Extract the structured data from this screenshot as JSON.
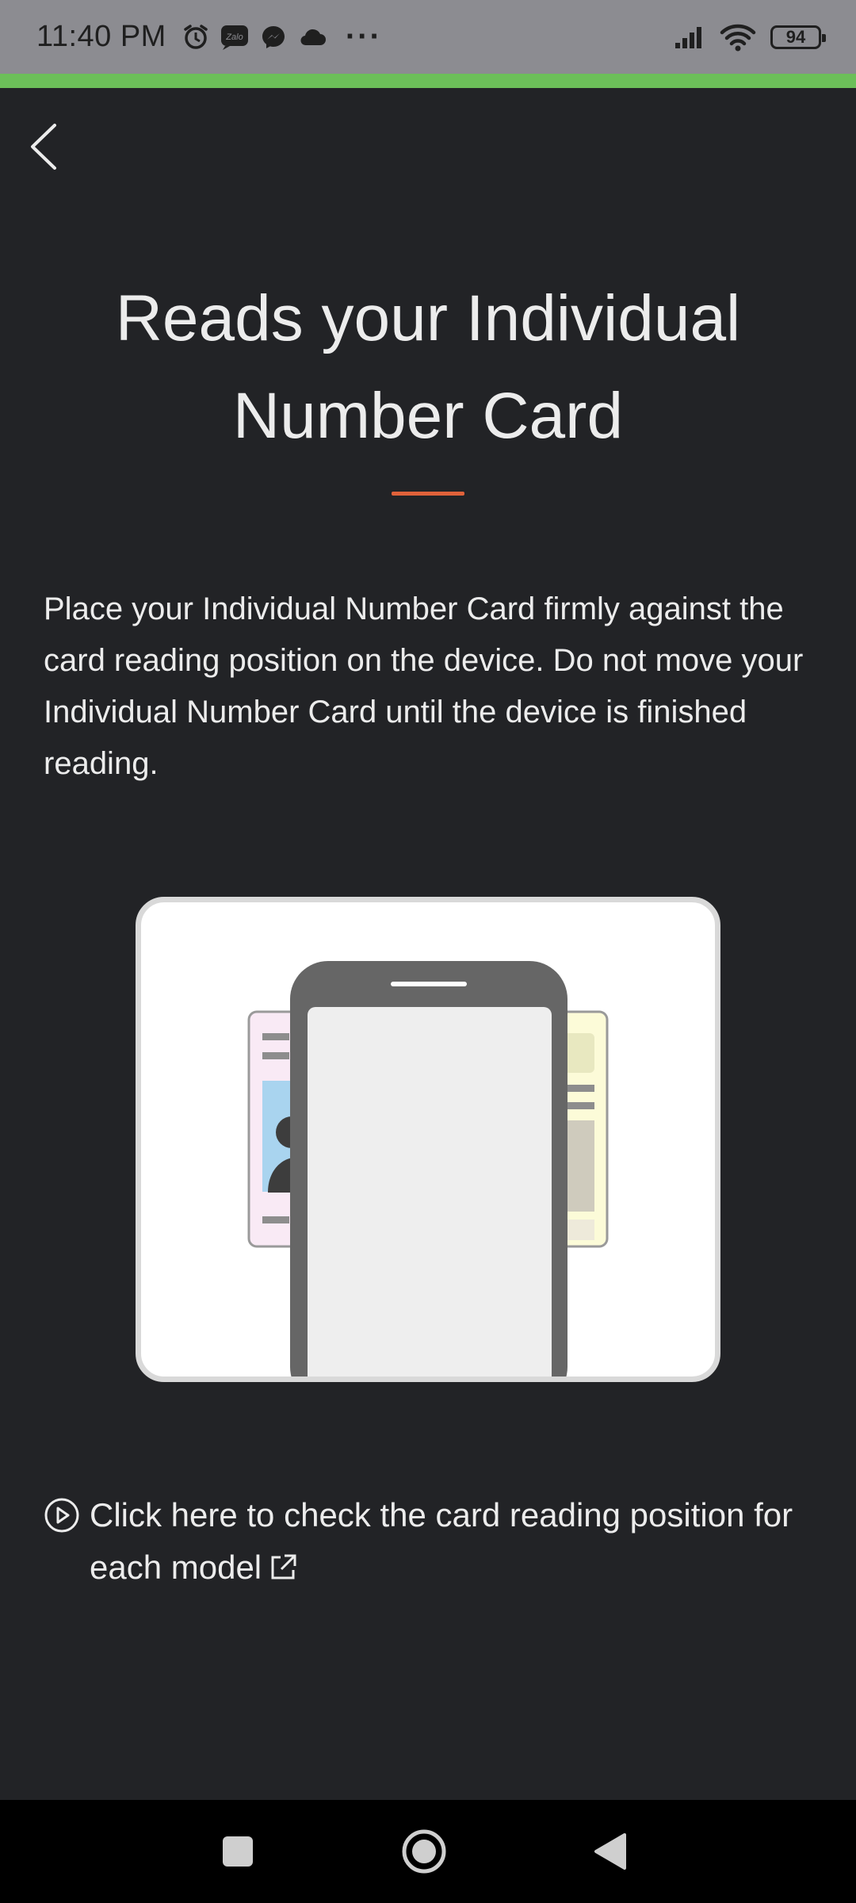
{
  "status_bar": {
    "time": "11:40 PM",
    "zalo_label": "Zalo",
    "more": "···",
    "battery": "94"
  },
  "colors": {
    "background": "#222326",
    "progress": "#6cbf59",
    "accent": "#e0623a"
  },
  "header": {
    "back_icon": "chevron-left-icon"
  },
  "main": {
    "title": "Reads your Individual Number Card",
    "description": "Place your Individual Number Card firmly against the card reading position on the device. Do not move your Individual Number Card until the device is finished reading.",
    "link_text": "Click here to check the card reading position for each model",
    "link_icon": "play-circle-icon",
    "external_icon": "external-link-icon"
  },
  "nav": {
    "recents_icon": "square-icon",
    "home_icon": "circle-icon",
    "back_icon": "triangle-back-icon"
  }
}
